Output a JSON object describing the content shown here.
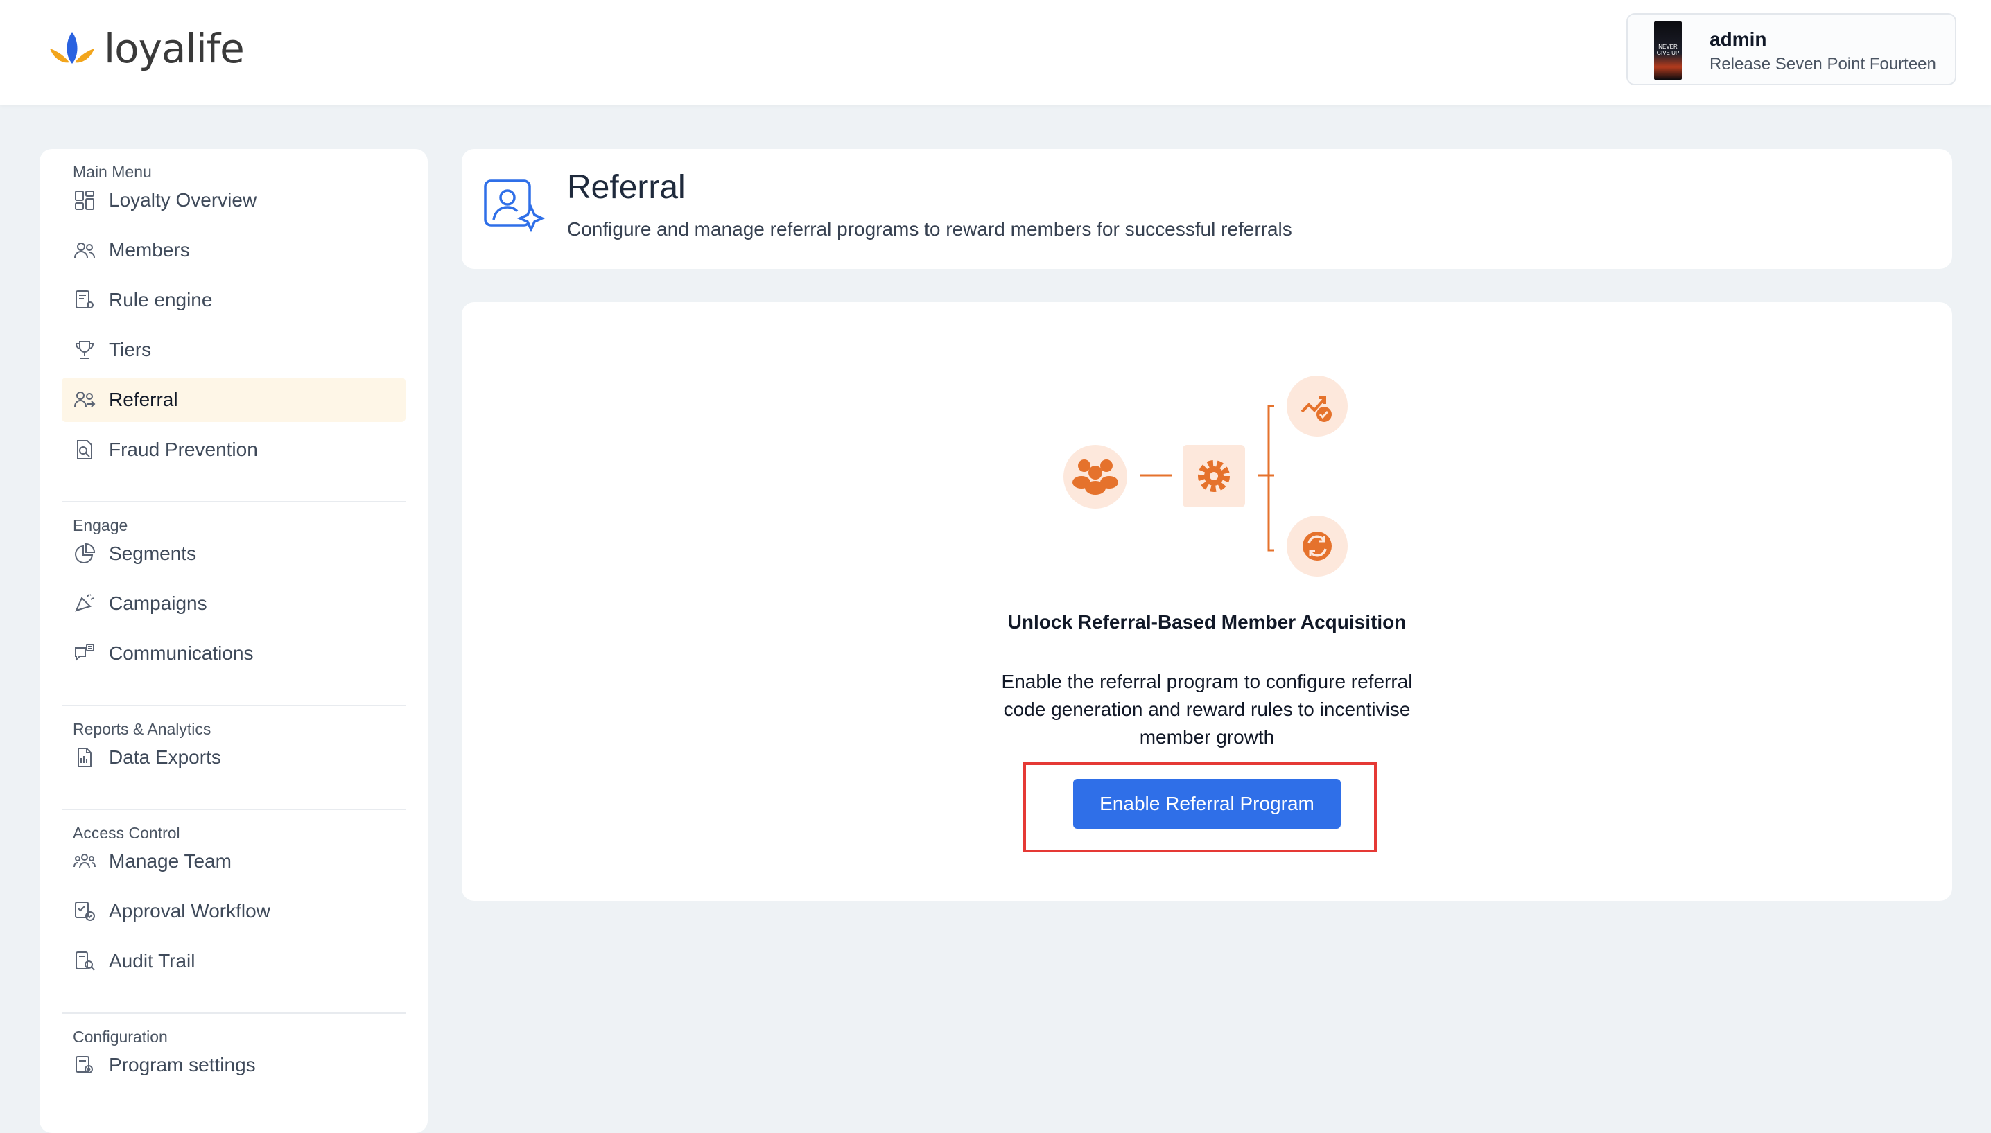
{
  "header": {
    "logo_text": "loyalife",
    "user": {
      "name": "admin",
      "role": "Release Seven Point Fourteen",
      "avatar_text": "NEVER GIVE UP"
    }
  },
  "sidebar": {
    "sections": [
      {
        "label": "Main Menu",
        "items": [
          {
            "label": "Loyalty Overview",
            "icon": "dashboard-icon"
          },
          {
            "label": "Members",
            "icon": "members-icon"
          },
          {
            "label": "Rule engine",
            "icon": "rule-engine-icon"
          },
          {
            "label": "Tiers",
            "icon": "trophy-icon"
          },
          {
            "label": "Referral",
            "icon": "referral-icon",
            "active": true
          },
          {
            "label": "Fraud Prevention",
            "icon": "fraud-prevention-icon"
          }
        ]
      },
      {
        "label": "Engage",
        "items": [
          {
            "label": "Segments",
            "icon": "pie-chart-icon"
          },
          {
            "label": "Campaigns",
            "icon": "megaphone-icon"
          },
          {
            "label": "Communications",
            "icon": "chat-icon"
          }
        ]
      },
      {
        "label": "Reports & Analytics",
        "items": [
          {
            "label": "Data Exports",
            "icon": "document-icon"
          }
        ]
      },
      {
        "label": "Access Control",
        "items": [
          {
            "label": "Manage Team",
            "icon": "team-icon"
          },
          {
            "label": "Approval Workflow",
            "icon": "approval-icon"
          },
          {
            "label": "Audit Trail",
            "icon": "audit-icon"
          }
        ]
      },
      {
        "label": "Configuration",
        "items": [
          {
            "label": "Program settings",
            "icon": "settings-icon"
          }
        ]
      }
    ]
  },
  "page": {
    "title": "Referral",
    "subtitle": "Configure and manage referral programs to reward members for successful referrals"
  },
  "empty_state": {
    "title": "Unlock Referral-Based Member Acquisition",
    "description": "Enable the referral program to configure referral code generation and reward rules to incentivise member growth",
    "button_label": "Enable Referral Program"
  },
  "colors": {
    "accent_orange": "#e5722c",
    "primary_blue": "#2f6fe8",
    "active_bg": "#fef6e7",
    "highlight_red": "#e53935"
  }
}
